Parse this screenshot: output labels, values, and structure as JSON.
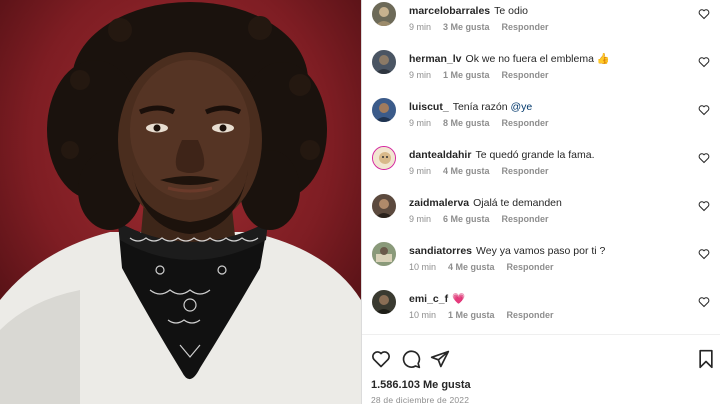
{
  "comments": [
    {
      "username": "marcelobarrales",
      "text": "Te odio",
      "time": "9 min",
      "likes": "3 Me gusta",
      "reply": "Responder",
      "avatar_color": "#6d6a58"
    },
    {
      "username": "herman_lv",
      "text": "Ok we no fuera el emblema",
      "emoji": "👍",
      "time": "9 min",
      "likes": "1 Me gusta",
      "reply": "Responder",
      "avatar_color": "#4a5563"
    },
    {
      "username": "luiscut_",
      "text": "Tenía razón",
      "mention": "@ye",
      "time": "9 min",
      "likes": "8 Me gusta",
      "reply": "Responder",
      "avatar_color": "#3b5b8a"
    },
    {
      "username": "dantealdahir",
      "text": "Te quedó grande la fama.",
      "time": "9 min",
      "likes": "4 Me gusta",
      "reply": "Responder",
      "avatar_color": "#d8b98a"
    },
    {
      "username": "zaidmalerva",
      "text": "Ojalá te demanden",
      "time": "9 min",
      "likes": "6 Me gusta",
      "reply": "Responder",
      "avatar_color": "#5c4a3e"
    },
    {
      "username": "sandiatorres",
      "text": "Wey ya vamos paso por ti ?",
      "time": "10 min",
      "likes": "4 Me gusta",
      "reply": "Responder",
      "avatar_color": "#8a9a7a"
    },
    {
      "username": "emi_c_f",
      "text": "",
      "emoji": "💗",
      "time": "10 min",
      "likes": "1 Me gusta",
      "reply": "Responder",
      "avatar_color": "#3a3a30"
    }
  ],
  "post": {
    "likes_total": "1.586.103 Me gusta",
    "date": "28 de diciembre de 2022"
  },
  "colors": {
    "background_red": "#7d1c22",
    "meta_gray": "#8e8e8e",
    "mention_blue": "#00376b",
    "heart_pink": "#ed4c8c"
  },
  "icons": {
    "like": "heart-icon",
    "comment": "comment-bubble-icon",
    "share": "paper-plane-icon",
    "save": "bookmark-icon"
  }
}
